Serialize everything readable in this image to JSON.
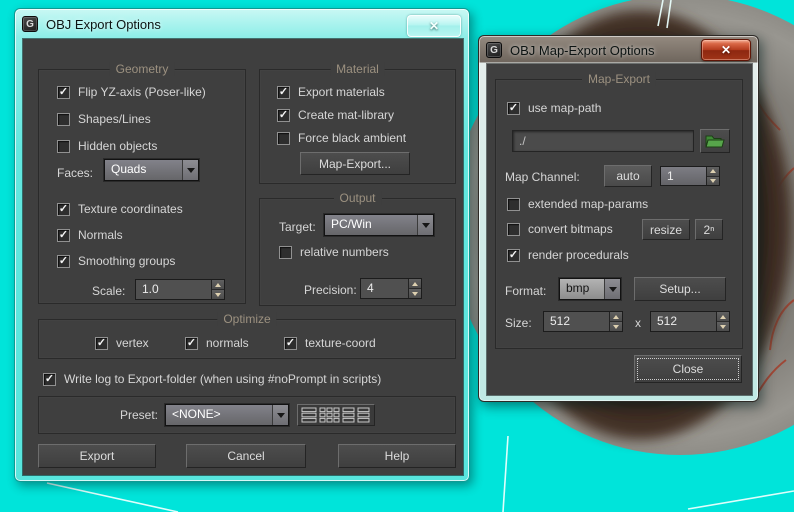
{
  "icons": {
    "check": "✓",
    "close": "✕",
    "app_badge": "G",
    "size_separator": "x"
  },
  "export_dialog": {
    "title": "OBJ Export Options",
    "geometry": {
      "title": "Geometry",
      "flip": {
        "label": "Flip YZ-axis (Poser-like)",
        "checked": true,
        "mark": "✓"
      },
      "shapes": {
        "label": "Shapes/Lines",
        "checked": false,
        "mark": ""
      },
      "hidden": {
        "label": "Hidden objects",
        "checked": false,
        "mark": ""
      },
      "faces_label": "Faces:",
      "faces_value": "Quads",
      "texcoords": {
        "label": "Texture coordinates",
        "checked": true,
        "mark": "✓"
      },
      "normals": {
        "label": "Normals",
        "checked": true,
        "mark": "✓"
      },
      "smoothing": {
        "label": "Smoothing groups",
        "checked": true,
        "mark": "✓"
      },
      "scale_label": "Scale:",
      "scale_value": "1.0"
    },
    "material": {
      "title": "Material",
      "export_materials": {
        "label": "Export materials",
        "checked": true,
        "mark": "✓"
      },
      "create_matlib": {
        "label": "Create mat-library",
        "checked": true,
        "mark": "✓"
      },
      "force_black": {
        "label": "Force black ambient",
        "checked": false,
        "mark": ""
      },
      "map_export_button": "Map-Export..."
    },
    "output": {
      "title": "Output",
      "target_label": "Target:",
      "target_value": "PC/Win",
      "relative": {
        "label": "relative numbers",
        "checked": false,
        "mark": ""
      },
      "precision_label": "Precision:",
      "precision_value": "4"
    },
    "optimize": {
      "title": "Optimize",
      "vertex": {
        "label": "vertex",
        "checked": true,
        "mark": "✓"
      },
      "normals": {
        "label": "normals",
        "checked": true,
        "mark": "✓"
      },
      "texcoord": {
        "label": "texture-coord",
        "checked": true,
        "mark": "✓"
      }
    },
    "write_log": {
      "label": "Write log to Export-folder (when using #noPrompt in scripts)",
      "checked": true,
      "mark": "✓"
    },
    "preset_label": "Preset:",
    "preset_value": "<NONE>",
    "export_button": "Export",
    "cancel_button": "Cancel",
    "help_button": "Help"
  },
  "map_dialog": {
    "title": "OBJ Map-Export Options",
    "group_title": "Map-Export",
    "use_map_path": {
      "label": "use map-path",
      "checked": true,
      "mark": "✓"
    },
    "path_value": "./",
    "map_channel_label": "Map Channel:",
    "auto_button": "auto",
    "channel_value": "1",
    "extended": {
      "label": "extended map-params",
      "checked": false,
      "mark": ""
    },
    "convert": {
      "label": "convert bitmaps",
      "checked": false,
      "mark": ""
    },
    "resize_button": "resize",
    "pow2_button": "2ⁿ",
    "render_procedurals": {
      "label": "render procedurals",
      "checked": true,
      "mark": "✓"
    },
    "format_label": "Format:",
    "format_value": "bmp",
    "setup_button": "Setup...",
    "size_label": "Size:",
    "size_width": "512",
    "size_height": "512",
    "close_button": "Close"
  }
}
